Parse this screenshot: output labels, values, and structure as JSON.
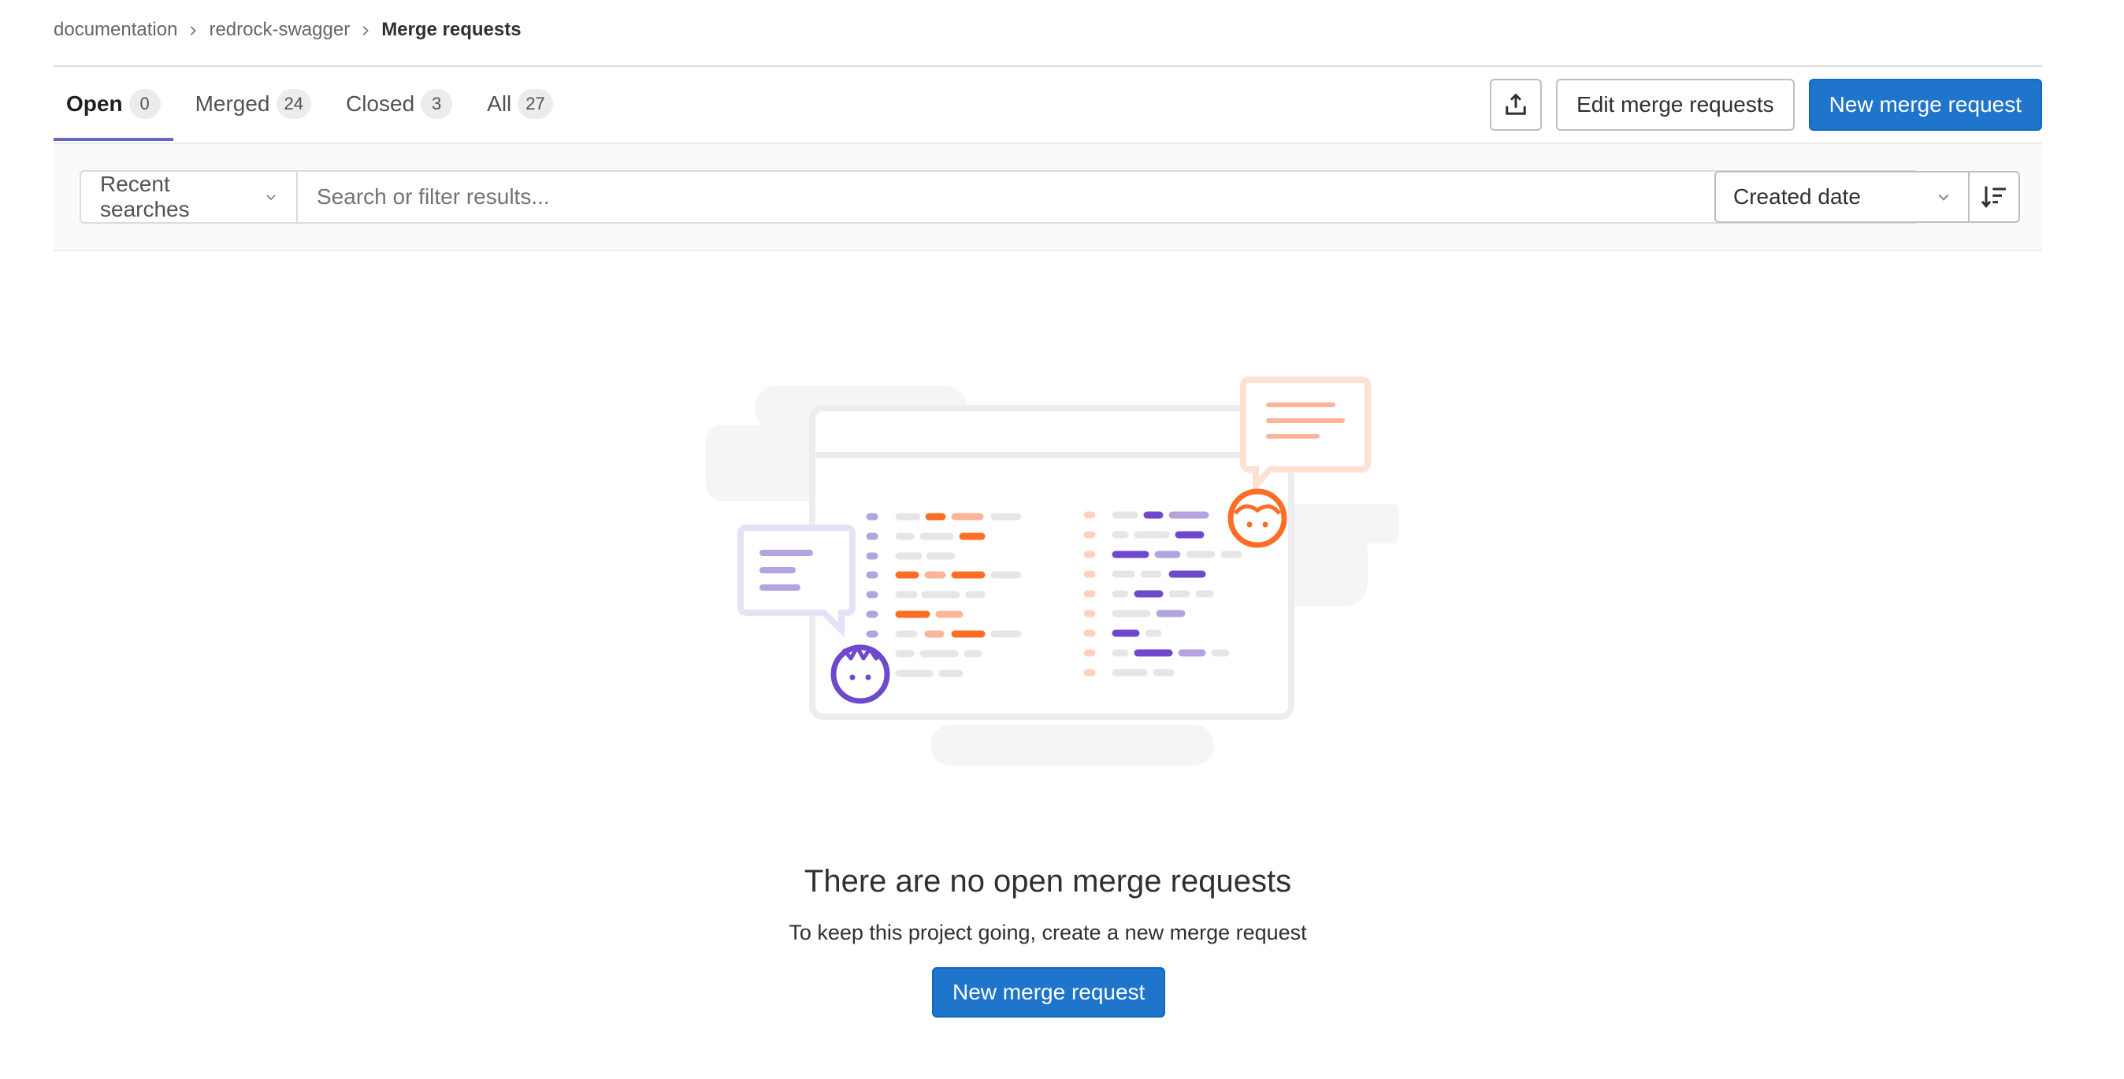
{
  "breadcrumb": {
    "items": [
      "documentation",
      "redrock-swagger",
      "Merge requests"
    ]
  },
  "tabs": [
    {
      "label": "Open",
      "count": "0"
    },
    {
      "label": "Merged",
      "count": "24"
    },
    {
      "label": "Closed",
      "count": "3"
    },
    {
      "label": "All",
      "count": "27"
    }
  ],
  "actions": {
    "export_icon": "export-icon",
    "edit_label": "Edit merge requests",
    "new_label": "New merge request"
  },
  "filter": {
    "recent_label": "Recent searches",
    "search_placeholder": "Search or filter results...",
    "sort_label": "Created date",
    "sort_direction_icon": "sort-lowest-icon"
  },
  "empty_state": {
    "title": "There are no open merge requests",
    "description": "To keep this project going, create a new merge request",
    "button_label": "New merge request"
  },
  "colors": {
    "primary": "#1f75cb",
    "tab_active": "#6666c4",
    "orange": "#fc6d26",
    "purple": "#6e49cb"
  }
}
